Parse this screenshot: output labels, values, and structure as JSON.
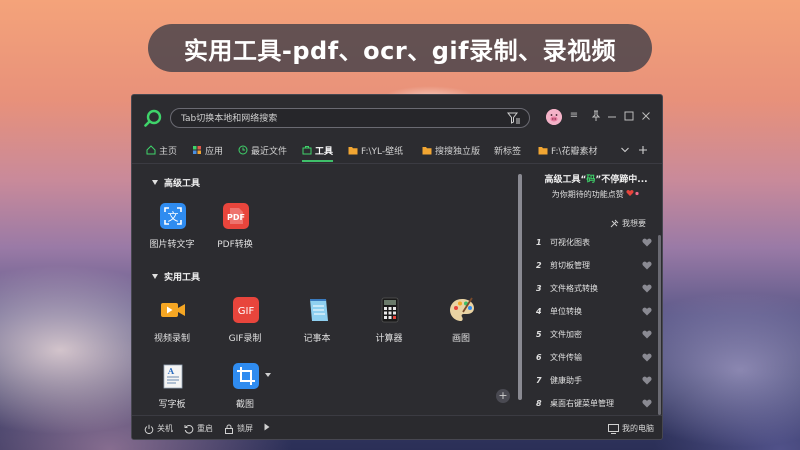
{
  "banner": {
    "title": "实用工具-pdf、ocr、gif录制、录视频"
  },
  "search": {
    "placeholder": "Tab切换本地和网络搜索"
  },
  "colors": {
    "accent": "#3fbf6a",
    "window_bg": "#2c2c30",
    "folder": "#f2a632"
  },
  "tabs": [
    {
      "label": "主页",
      "icon": "home-icon"
    },
    {
      "label": "应用",
      "icon": "apps-icon"
    },
    {
      "label": "最近文件",
      "icon": "clock-icon"
    },
    {
      "label": "工具",
      "icon": "toolbox-icon",
      "active": true
    },
    {
      "label": "F:\\YL-壁纸",
      "icon": "folder-icon"
    },
    {
      "label": "搜搜独立版",
      "icon": "folder-icon"
    },
    {
      "label": "新标签",
      "icon": ""
    },
    {
      "label": "F:\\花瓣素材",
      "icon": "folder-icon"
    }
  ],
  "sections": {
    "advanced": {
      "title": "高级工具",
      "tools": [
        {
          "label": "图片转文字",
          "icon": "image-to-text-icon"
        },
        {
          "label": "PDF转换",
          "icon": "pdf-icon"
        }
      ]
    },
    "practical": {
      "title": "实用工具",
      "tools": [
        {
          "label": "视频录制",
          "icon": "video-record-icon"
        },
        {
          "label": "GIF录制",
          "icon": "gif-icon"
        },
        {
          "label": "记事本",
          "icon": "notepad-icon"
        },
        {
          "label": "计算器",
          "icon": "calculator-icon"
        },
        {
          "label": "画图",
          "icon": "paint-icon"
        },
        {
          "label": "写字板",
          "icon": "wordpad-icon"
        },
        {
          "label": "截图",
          "icon": "screenshot-icon"
        }
      ]
    }
  },
  "right_panel": {
    "title_pre": "高级工具“",
    "title_hl": "码",
    "title_post": "”不停蹄中...",
    "subtitle": "为你期待的功能点赞",
    "wish_label": "我想要",
    "ranking": [
      {
        "num": "1",
        "label": "可视化图表"
      },
      {
        "num": "2",
        "label": "剪切板管理"
      },
      {
        "num": "3",
        "label": "文件格式转换"
      },
      {
        "num": "4",
        "label": "单位转换"
      },
      {
        "num": "5",
        "label": "文件加密"
      },
      {
        "num": "6",
        "label": "文件传输"
      },
      {
        "num": "7",
        "label": "健康助手"
      },
      {
        "num": "8",
        "label": "桌面右键菜单管理"
      }
    ]
  },
  "statusbar": {
    "shutdown": "关机",
    "restart": "重启",
    "lock": "锁屏",
    "my_computer": "我的电脑"
  }
}
